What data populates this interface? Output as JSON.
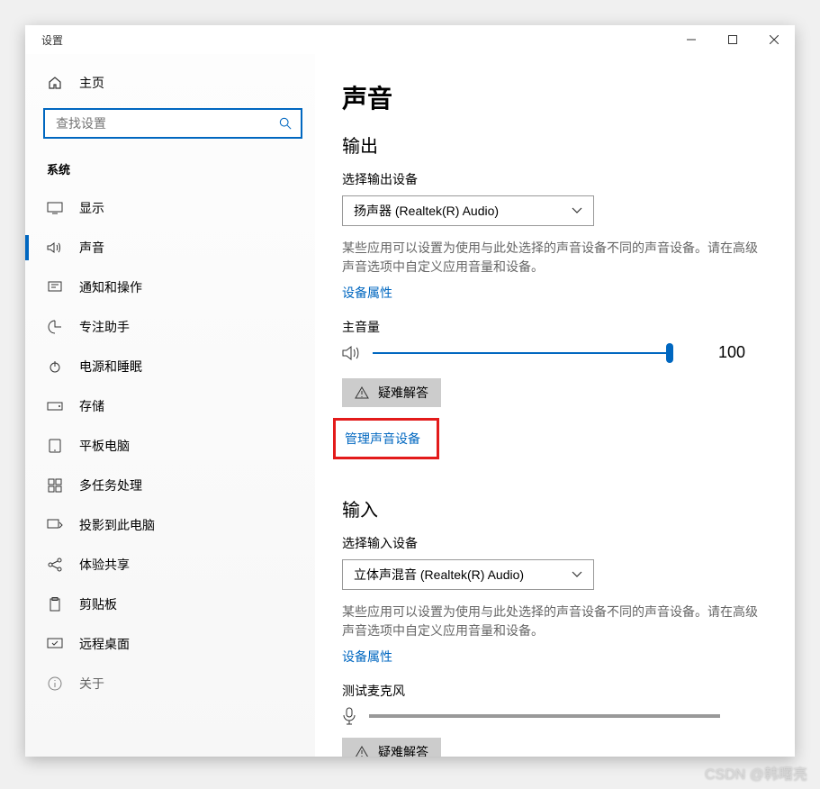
{
  "window_title": "设置",
  "home_label": "主页",
  "search": {
    "placeholder": "查找设置"
  },
  "section_label": "系统",
  "nav": [
    {
      "id": "display",
      "label": "显示"
    },
    {
      "id": "sound",
      "label": "声音"
    },
    {
      "id": "notifications",
      "label": "通知和操作"
    },
    {
      "id": "focus",
      "label": "专注助手"
    },
    {
      "id": "power",
      "label": "电源和睡眠"
    },
    {
      "id": "storage",
      "label": "存储"
    },
    {
      "id": "tablet",
      "label": "平板电脑"
    },
    {
      "id": "multitask",
      "label": "多任务处理"
    },
    {
      "id": "project",
      "label": "投影到此电脑"
    },
    {
      "id": "shared",
      "label": "体验共享"
    },
    {
      "id": "clipboard",
      "label": "剪贴板"
    },
    {
      "id": "remote",
      "label": "远程桌面"
    },
    {
      "id": "about",
      "label": "关于"
    }
  ],
  "page_title": "声音",
  "output": {
    "heading": "输出",
    "select_label": "选择输出设备",
    "selected": "扬声器 (Realtek(R) Audio)",
    "description": "某些应用可以设置为使用与此处选择的声音设备不同的声音设备。请在高级声音选项中自定义应用音量和设备。",
    "props_link": "设备属性",
    "volume_label": "主音量",
    "volume_value": "100",
    "troubleshoot": "疑难解答",
    "manage_link": "管理声音设备"
  },
  "input": {
    "heading": "输入",
    "select_label": "选择输入设备",
    "selected": "立体声混音 (Realtek(R) Audio)",
    "description": "某些应用可以设置为使用与此处选择的声音设备不同的声音设备。请在高级声音选项中自定义应用音量和设备。",
    "props_link": "设备属性",
    "test_label": "测试麦克风",
    "troubleshoot": "疑难解答"
  },
  "watermark": "CSDN @韩曙亮"
}
